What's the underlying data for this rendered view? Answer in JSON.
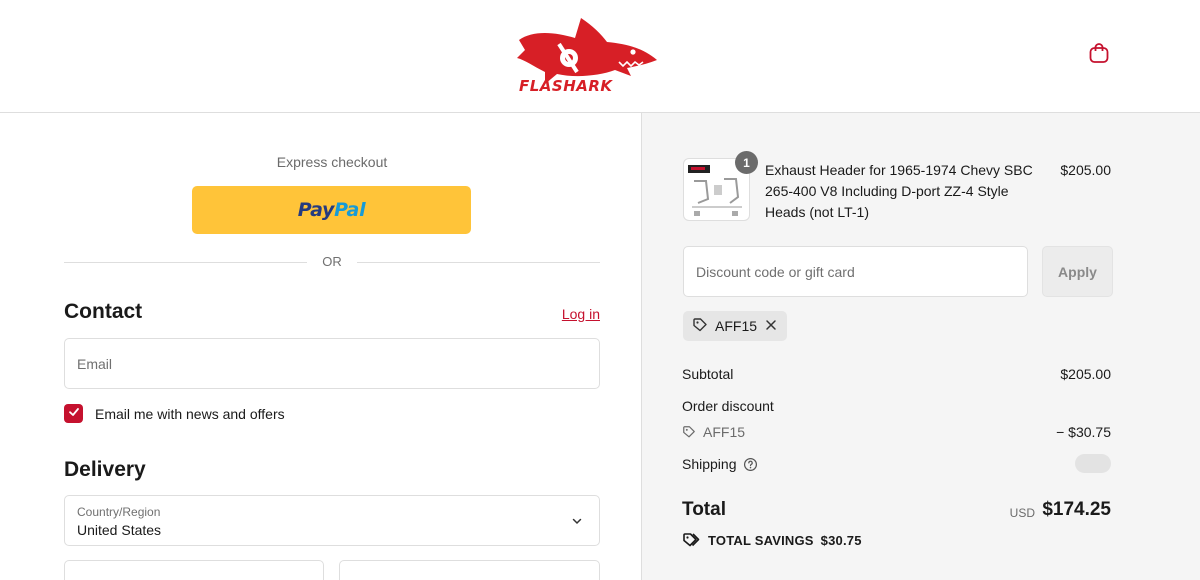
{
  "header": {
    "brand": "FLASHARK",
    "brand_color": "#d71f26",
    "cart_icon": "shopping-bag-icon"
  },
  "express": {
    "label": "Express checkout",
    "paypal_part1": "Pay",
    "paypal_part2": "Pal",
    "or_text": "OR"
  },
  "contact": {
    "title": "Contact",
    "login_label": "Log in",
    "email_placeholder": "Email",
    "newsletter_label": "Email me with news and offers",
    "newsletter_checked": true
  },
  "delivery": {
    "title": "Delivery",
    "country_label": "Country/Region",
    "country_value": "United States"
  },
  "summary": {
    "product": {
      "title": "Exhaust Header for 1965-1974 Chevy SBC 265-400 V8 Including D-port ZZ-4 Style Heads (not LT-1)",
      "price": "$205.00",
      "quantity": "1"
    },
    "discount_placeholder": "Discount code or gift card",
    "apply_label": "Apply",
    "applied_code": "AFF15",
    "subtotal_label": "Subtotal",
    "subtotal_value": "$205.00",
    "order_discount_label": "Order discount",
    "discount_code": "AFF15",
    "discount_value": "− $30.75",
    "shipping_label": "Shipping",
    "total_label": "Total",
    "total_currency": "USD",
    "total_value": "$174.25",
    "savings_label": "TOTAL SAVINGS",
    "savings_value": "$30.75"
  },
  "colors": {
    "accent": "#c5112e",
    "paypal_yellow": "#ffc439"
  }
}
